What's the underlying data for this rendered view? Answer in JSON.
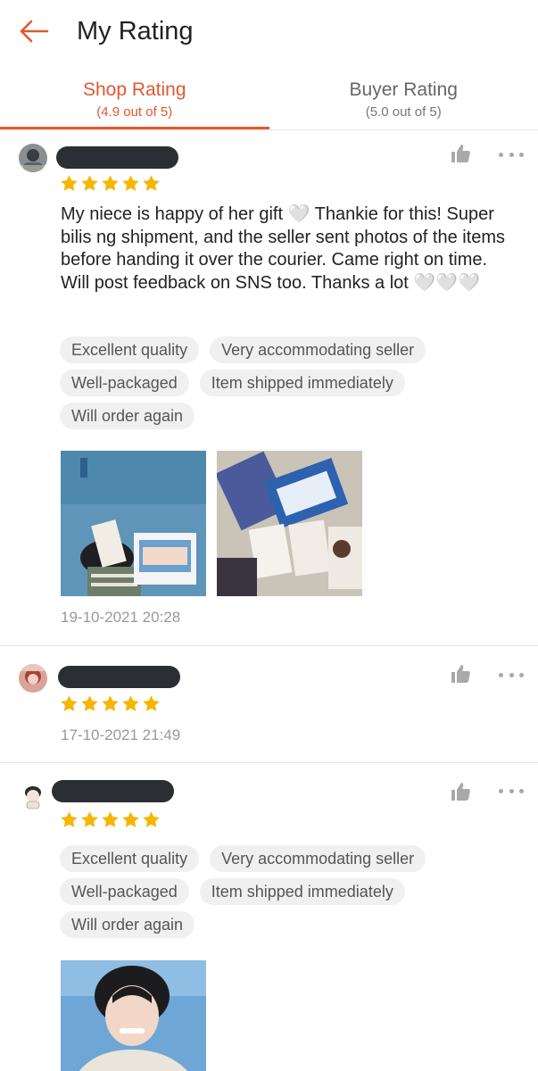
{
  "header": {
    "title": "My Rating"
  },
  "tabs": [
    {
      "label": "Shop Rating",
      "sub": "(4.9 out of 5)",
      "active": true
    },
    {
      "label": "Buyer Rating",
      "sub": "(5.0 out of 5)",
      "active": false
    }
  ],
  "colors": {
    "accent": "#e4572e",
    "star": "#f7b500",
    "chip_bg": "#f0f0f0"
  },
  "reviews": [
    {
      "rating": 5,
      "comment": "My niece is happy of her gift 🤍 Thankie for this! Super bilis ng shipment, and the seller sent photos of the items before handing it over the courier. Came right on time. Will post feedback on SNS too. Thanks a lot 🤍🤍🤍",
      "tags": [
        "Excellent quality",
        "Very accommodating seller",
        "Well-packaged",
        "Item shipped immediately",
        "Will order again"
      ],
      "date": "19-10-2021 20:28"
    },
    {
      "rating": 5,
      "date": "17-10-2021 21:49"
    },
    {
      "rating": 5,
      "tags": [
        "Excellent quality",
        "Very accommodating seller",
        "Well-packaged",
        "Item shipped immediately",
        "Will order again"
      ]
    }
  ]
}
